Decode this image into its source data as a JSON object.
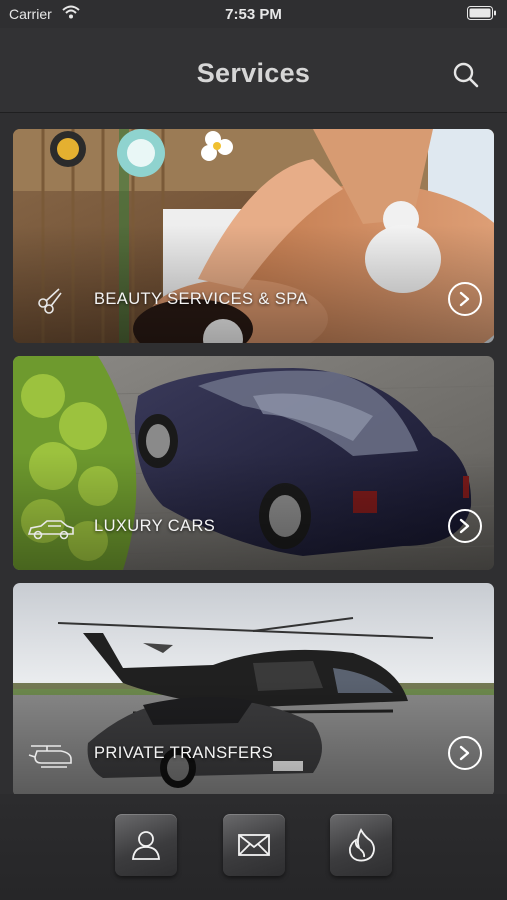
{
  "status_bar": {
    "carrier": "Carrier",
    "time": "7:53 PM"
  },
  "header": {
    "title": "Services",
    "search_icon": "search-icon"
  },
  "services": [
    {
      "label": "BEAUTY SERVICES & SPA",
      "icon": "spa-icon"
    },
    {
      "label": "LUXURY CARS",
      "icon": "car-icon"
    },
    {
      "label": "PRIVATE TRANSFERS",
      "icon": "helicopter-icon"
    }
  ],
  "tab_bar": {
    "items": [
      {
        "icon": "profile-icon"
      },
      {
        "icon": "mail-icon"
      },
      {
        "icon": "fire-icon"
      }
    ]
  },
  "colors": {
    "background": "#2f2f31",
    "title": "#d6d6d6"
  }
}
